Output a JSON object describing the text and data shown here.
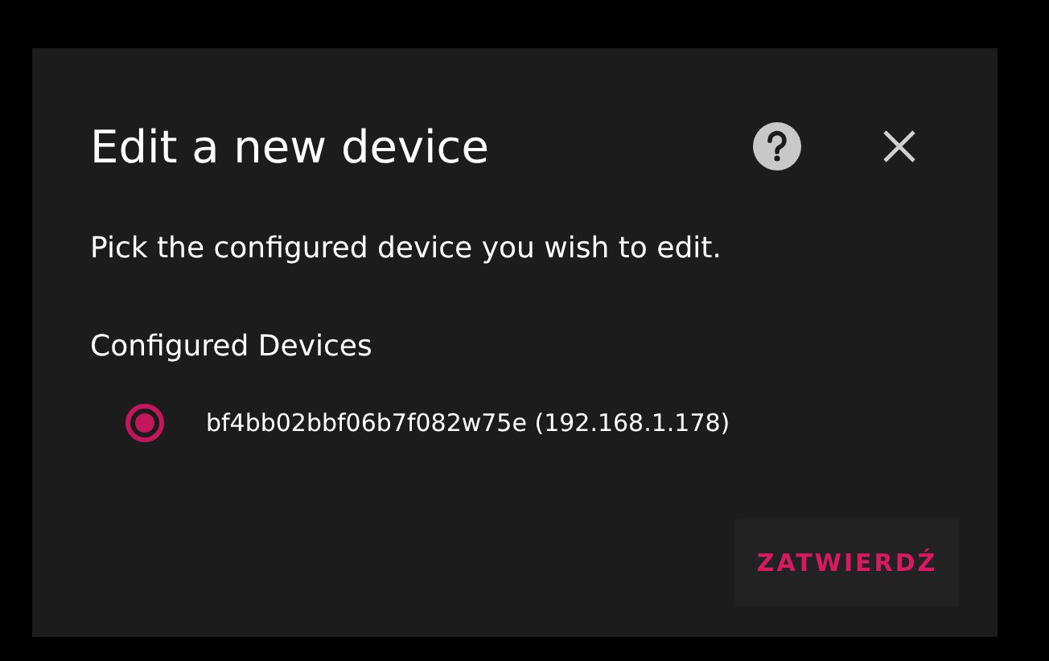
{
  "dialog": {
    "title": "Edit a new device",
    "description": "Pick the configured device you wish to edit.",
    "section_label": "Configured Devices",
    "options": [
      {
        "label": "bf4bb02bbf06b7f082w75e (192.168.1.178)",
        "selected": true
      }
    ],
    "buttons": [
      "ZATWIERDŹ"
    ]
  }
}
